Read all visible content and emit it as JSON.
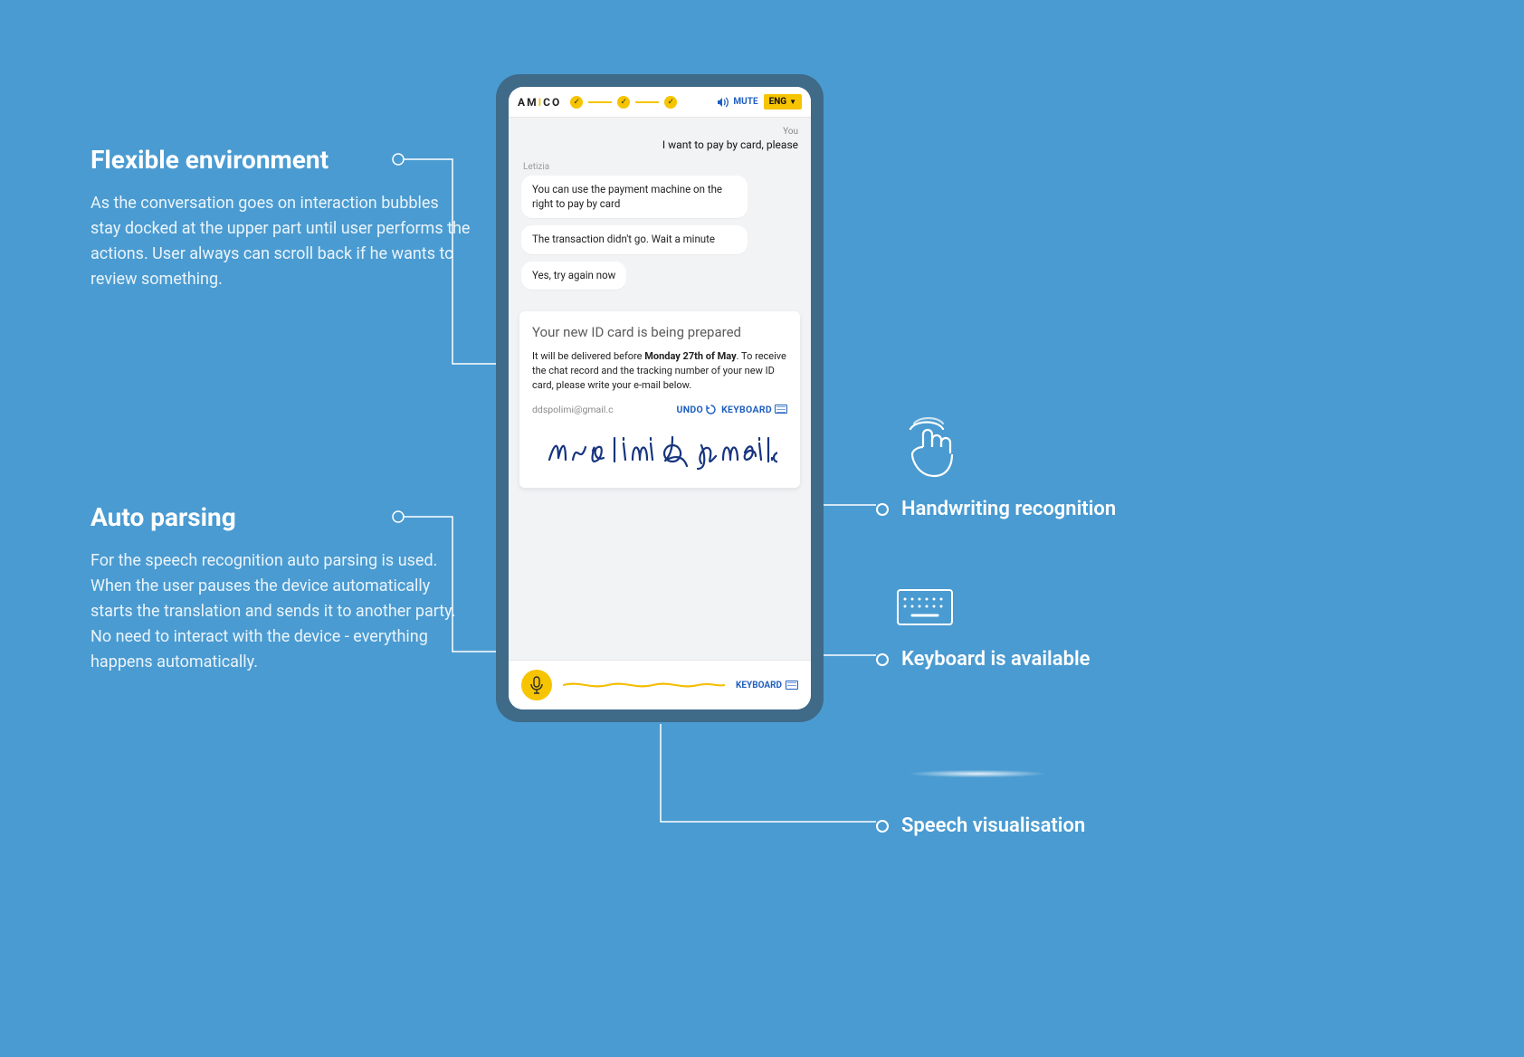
{
  "annotations": {
    "flexible": {
      "title": "Flexible environment",
      "body": "As the conversation goes on interaction bubbles stay docked at the upper part until user performs the actions. User always can scroll back if he wants to review something."
    },
    "autoparse": {
      "title": "Auto parsing",
      "body": "For the speech recognition auto parsing is used.  When the user pauses the device automatically starts the translation and sends it to another party. No need to interact with the device - everything happens automatically."
    },
    "handwriting": "Handwriting recognition",
    "keyboard": "Keyboard is available",
    "speech": "Speech visualisation"
  },
  "app": {
    "brand_pre": "AM",
    "brand_i": "I",
    "brand_post": "CO",
    "mute_label": "MUTE",
    "lang_label": "ENG"
  },
  "chat": {
    "you_label": "You",
    "you_msg": "I want to pay by card, please",
    "agent_name": "Letizia",
    "agent_msgs": [
      "You can use the payment machine on the right to pay by card",
      "The transaction didn't go. Wait a minute",
      "Yes, try again now"
    ]
  },
  "card": {
    "title": "Your new ID card is being prepared",
    "body_pre": "It will be delivered before ",
    "body_bold": "Monday 27th of May",
    "body_post": ". To receive the chat record and the tracking number of your new ID card, please write your e-mail below.",
    "parsed_value": "ddspolimi@gmail.c",
    "undo_label": "UNDO",
    "keyboard_label": "KEYBOARD",
    "handwritten_text": "ddspolimi@gmail.c"
  },
  "bottom": {
    "keyboard_label": "KEYBOARD"
  }
}
